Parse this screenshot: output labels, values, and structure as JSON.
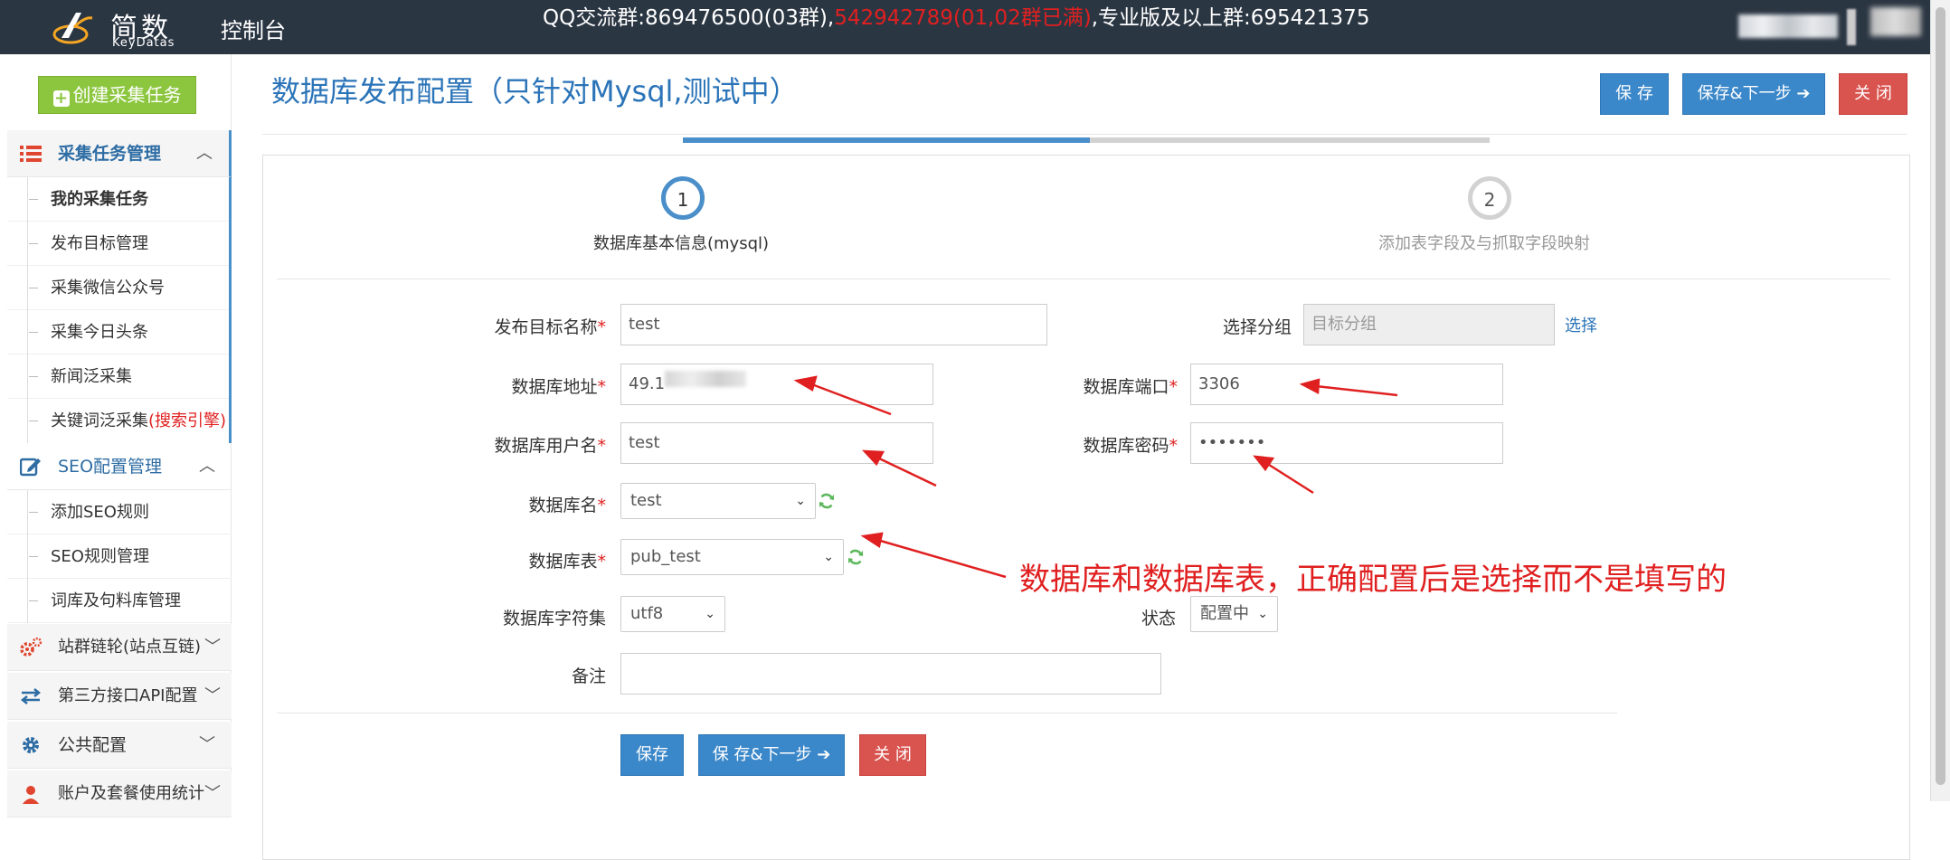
{
  "header": {
    "logo_cn": "简数",
    "logo_en": "KeyDatas",
    "console": "控制台",
    "qq_prefix": "QQ交流群:869476500(03群),",
    "qq_red": "542942789(01,02群已满)",
    "qq_suffix": ",专业版及以上群:695421375"
  },
  "sidebar": {
    "create_button": "创建采集任务",
    "sections": [
      {
        "label": "采集任务管理",
        "icon": "list-icon",
        "active": true,
        "items": [
          "我的采集任务",
          "发布目标管理",
          "采集微信公众号",
          "采集今日头条",
          "新闻泛采集",
          "关键词泛采集"
        ],
        "item_suffix_red": "(搜索引擎)"
      },
      {
        "label": "SEO配置管理",
        "icon": "edit-icon",
        "items": [
          "添加SEO规则",
          "SEO规则管理",
          "词库及句料库管理"
        ]
      },
      {
        "label": "站群链轮(站点互链)",
        "icon": "gears-icon"
      },
      {
        "label": "第三方接口API配置",
        "icon": "exchange-icon"
      },
      {
        "label": "公共配置",
        "icon": "gear-icon"
      },
      {
        "label": "账户及套餐使用统计",
        "icon": "user-icon"
      }
    ]
  },
  "main": {
    "title": "数据库发布配置（只针对Mysql,测试中）",
    "top_buttons": {
      "save": "保 存",
      "save_next": "保存&下一步",
      "close": "关 闭"
    },
    "steps": [
      {
        "num": "1",
        "label": "数据库基本信息(mysql)"
      },
      {
        "num": "2",
        "label": "添加表字段及与抓取字段映射"
      }
    ],
    "form": {
      "target_name_label": "发布目标名称",
      "target_name_value": "test",
      "group_label": "选择分组",
      "group_placeholder": "目标分组",
      "group_link": "选择",
      "db_host_label": "数据库地址",
      "db_host_value": "49.1",
      "db_port_label": "数据库端口",
      "db_port_value": "3306",
      "db_user_label": "数据库用户名",
      "db_user_value": "test",
      "db_pass_label": "数据库密码",
      "db_pass_value": "•••••••",
      "db_name_label": "数据库名",
      "db_name_value": "test",
      "db_table_label": "数据库表",
      "db_table_value": "pub_test",
      "charset_label": "数据库字符集",
      "charset_value": "utf8",
      "status_label": "状态",
      "status_value": "配置中",
      "note_label": "备注",
      "note_value": ""
    },
    "bottom_buttons": {
      "save": "保存",
      "save_next": "保 存&下一步",
      "close": "关 闭"
    },
    "annotation": "数据库和数据库表，正确配置后是选择而不是填写的"
  },
  "colors": {
    "topbar": "#2b3643",
    "accent": "#3a87c9",
    "danger": "#d9534f",
    "annotation": "#e02020",
    "create": "#8cc63f"
  }
}
